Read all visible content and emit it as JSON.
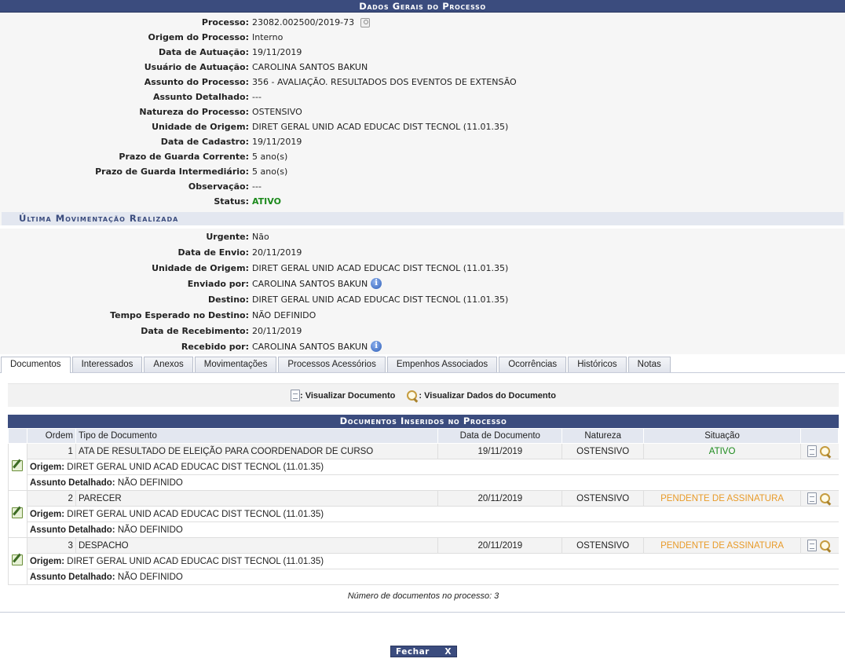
{
  "header": {
    "title": "Dados Gerais do Processo"
  },
  "general": [
    {
      "label": "Processo:",
      "value": "23082.002500/2019-73"
    },
    {
      "label": "Origem do Processo:",
      "value": "Interno"
    },
    {
      "label": "Data de Autuação:",
      "value": "19/11/2019"
    },
    {
      "label": "Usuário de Autuação:",
      "value": "CAROLINA SANTOS BAKUN"
    },
    {
      "label": "Assunto do Processo:",
      "value": "356 - AVALIAÇÃO. RESULTADOS DOS EVENTOS DE EXTENSÃO"
    },
    {
      "label": "Assunto Detalhado:",
      "value": "---"
    },
    {
      "label": "Natureza do Processo:",
      "value": "OSTENSIVO"
    },
    {
      "label": "Unidade de Origem:",
      "value": "DIRET GERAL UNID ACAD EDUCAC DIST TECNOL (11.01.35)"
    },
    {
      "label": "Data de Cadastro:",
      "value": "19/11/2019"
    },
    {
      "label": "Prazo de Guarda Corrente:",
      "value": "5 ano(s)"
    },
    {
      "label": "Prazo de Guarda Intermediário:",
      "value": "5 ano(s)"
    },
    {
      "label": "Observação:",
      "value": "---"
    },
    {
      "label": "Status:",
      "value": "ATIVO"
    }
  ],
  "movement": {
    "title": "Última Movimentação Realizada",
    "rows": [
      {
        "label": "Urgente:",
        "value": "Não"
      },
      {
        "label": "Data de Envio:",
        "value": "20/11/2019"
      },
      {
        "label": "Unidade de Origem:",
        "value": "DIRET GERAL UNID ACAD EDUCAC DIST TECNOL (11.01.35)"
      },
      {
        "label": "Enviado por:",
        "value": "CAROLINA SANTOS BAKUN"
      },
      {
        "label": "Destino:",
        "value": "DIRET GERAL UNID ACAD EDUCAC DIST TECNOL (11.01.35)"
      },
      {
        "label": "Tempo Esperado no Destino:",
        "value": "NÃO DEFINIDO"
      },
      {
        "label": "Data de Recebimento:",
        "value": "20/11/2019"
      },
      {
        "label": "Recebido por:",
        "value": "CAROLINA SANTOS BAKUN"
      }
    ]
  },
  "tabs": [
    "Documentos",
    "Interessados",
    "Anexos",
    "Movimentações",
    "Processos Acessórios",
    "Empenhos Associados",
    "Ocorrências",
    "Históricos",
    "Notas"
  ],
  "legend": {
    "view_doc": ": Visualizar Documento",
    "view_data": ": Visualizar Dados do Documento"
  },
  "docs": {
    "caption": "Documentos Inseridos no Processo",
    "columns": [
      "Ordem",
      "Tipo de Documento",
      "Data de Documento",
      "Natureza",
      "Situação"
    ],
    "origin_label": "Origem:",
    "subject_label": "Assunto Detalhado:",
    "rows": [
      {
        "order": "1",
        "type": "ATA DE RESULTADO DE ELEIÇÃO PARA COORDENADOR DE CURSO",
        "date": "19/11/2019",
        "nature": "OSTENSIVO",
        "status": "ATIVO",
        "origin": "DIRET GERAL UNID ACAD EDUCAC DIST TECNOL (11.01.35)",
        "subject": "NÃO DEFINIDO"
      },
      {
        "order": "2",
        "type": "PARECER",
        "date": "20/11/2019",
        "nature": "OSTENSIVO",
        "status": "PENDENTE DE ASSINATURA",
        "origin": "DIRET GERAL UNID ACAD EDUCAC DIST TECNOL (11.01.35)",
        "subject": "NÃO DEFINIDO"
      },
      {
        "order": "3",
        "type": "DESPACHO",
        "date": "20/11/2019",
        "nature": "OSTENSIVO",
        "status": "PENDENTE DE ASSINATURA",
        "origin": "DIRET GERAL UNID ACAD EDUCAC DIST TECNOL (11.01.35)",
        "subject": "NÃO DEFINIDO"
      }
    ],
    "count_text": "Número de documentos no processo: 3"
  },
  "close_button": {
    "label": "Fechar",
    "x": "X"
  },
  "colors": {
    "header": "#3b4c7e",
    "ativo": "#1c8a1c",
    "pendente": "#e89b2a"
  }
}
